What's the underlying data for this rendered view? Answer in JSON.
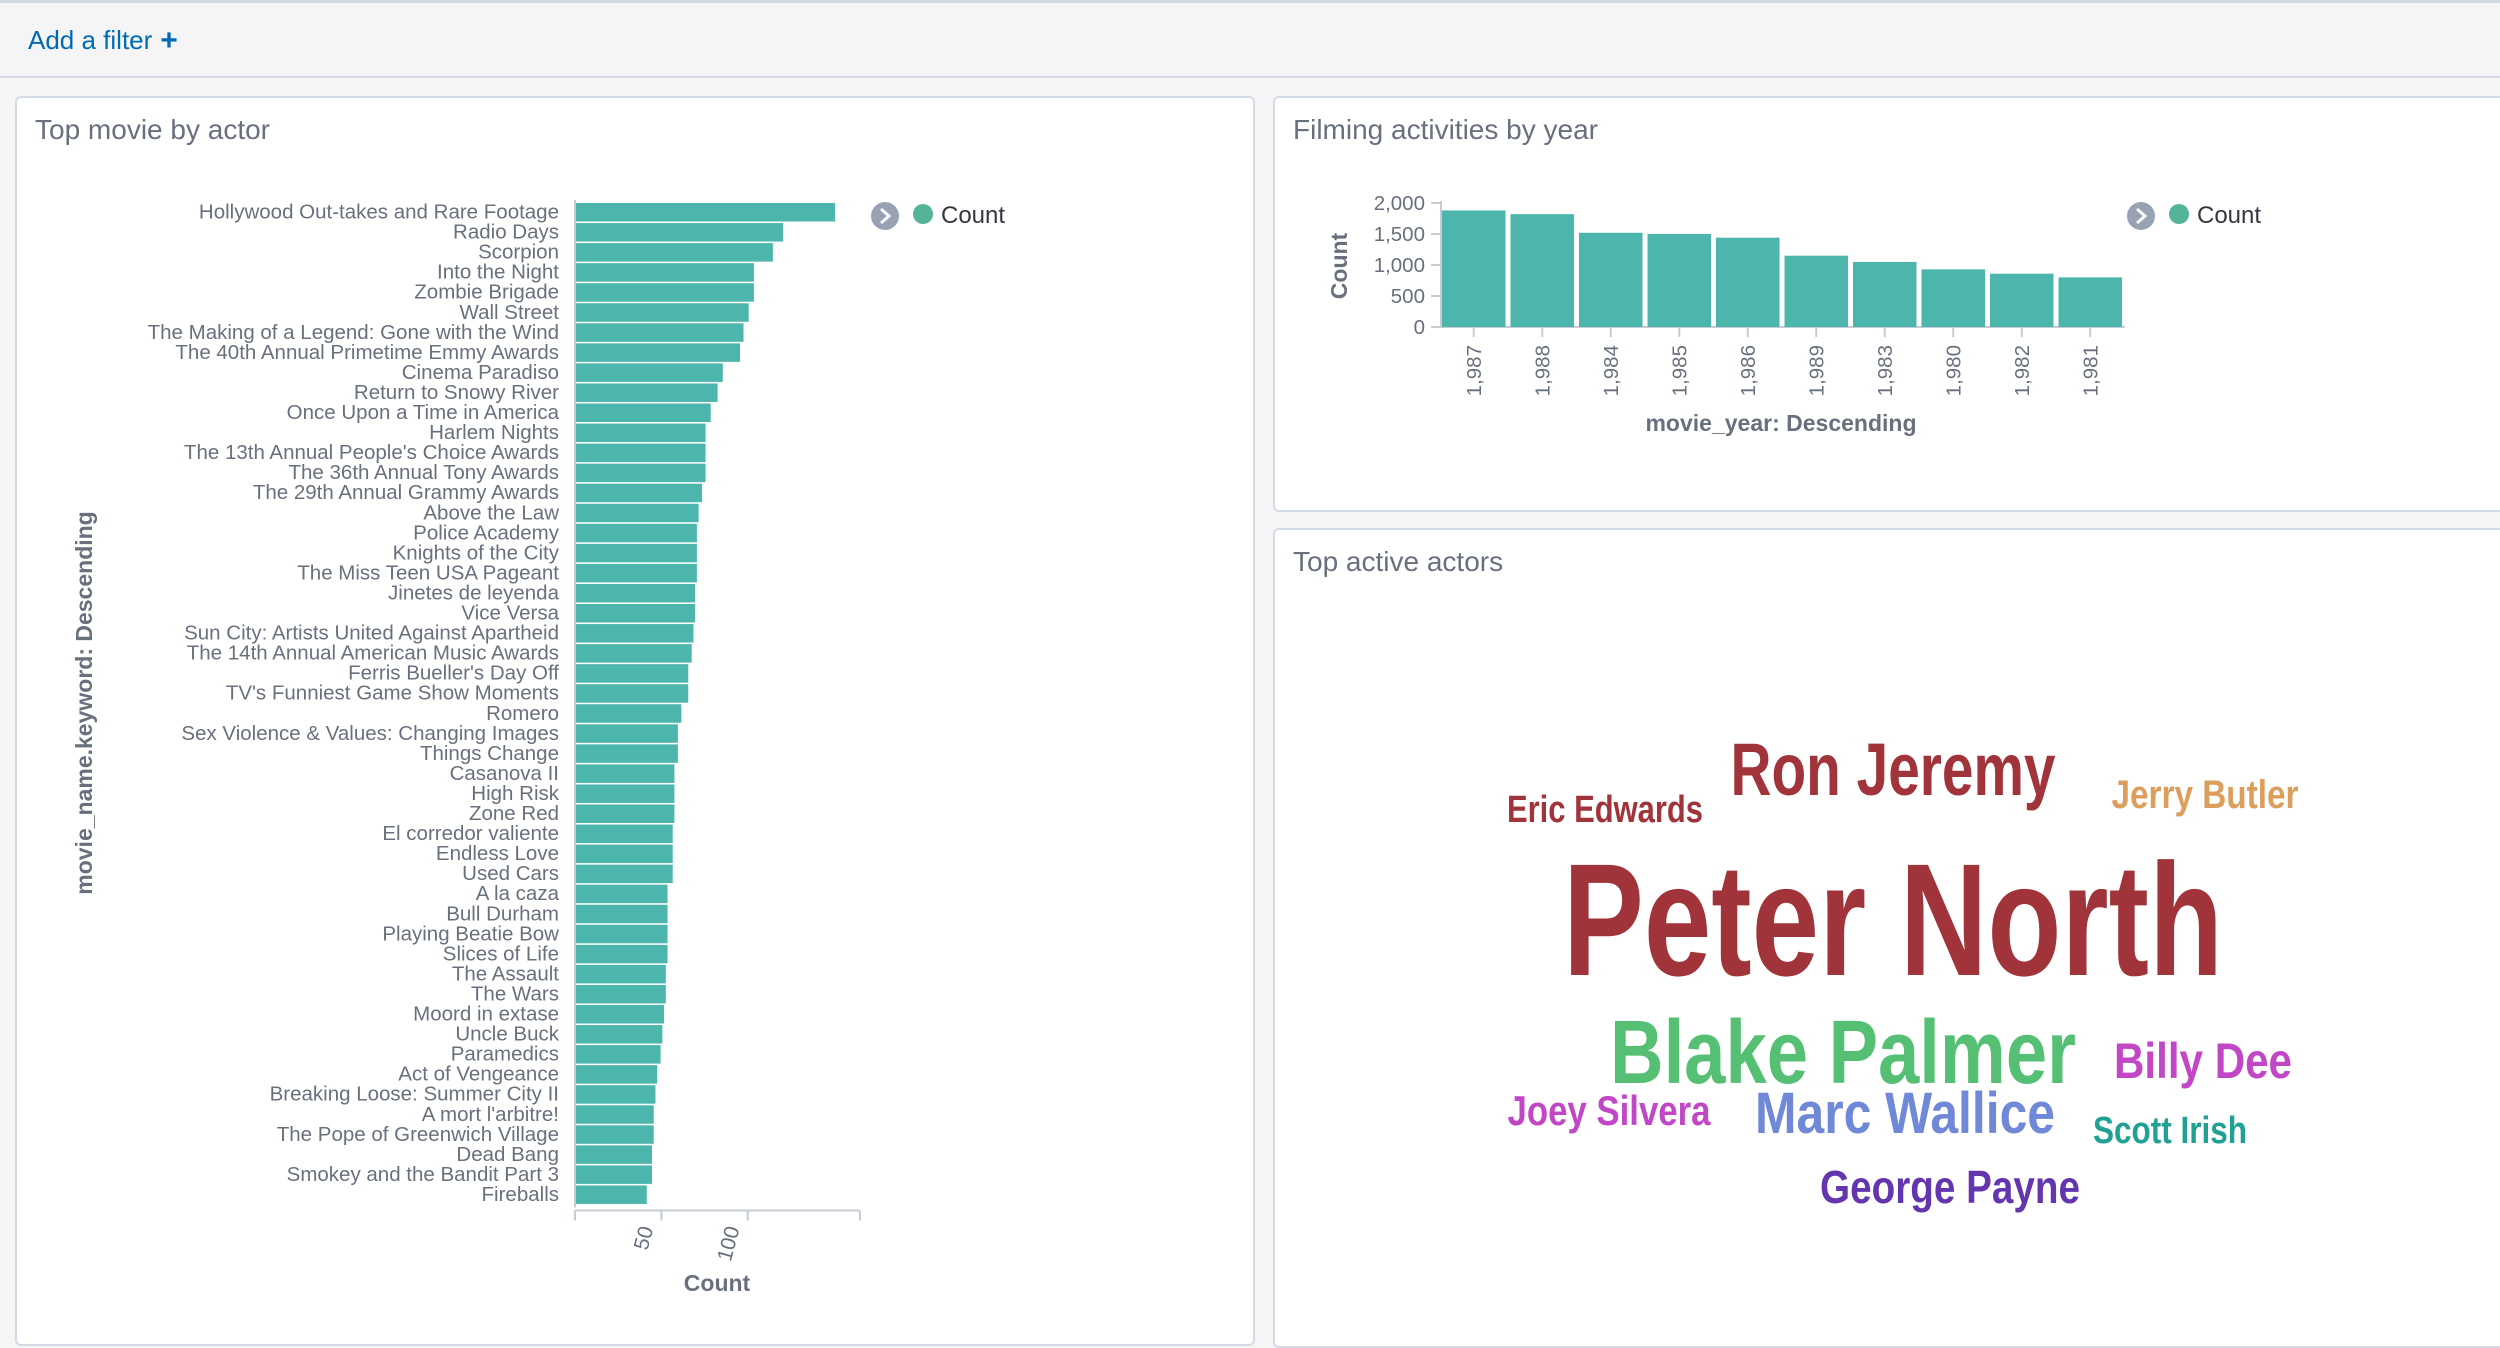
{
  "filter_bar": {
    "add_filter_label": "Add a filter"
  },
  "panels": {
    "top_movie": {
      "title": "Top movie by actor"
    },
    "filming": {
      "title": "Filming activities by year"
    },
    "actors": {
      "title": "Top active actors"
    }
  },
  "chart_data": [
    {
      "type": "bar",
      "orientation": "horizontal",
      "categories": [
        "Hollywood Out-takes and Rare Footage",
        "Radio Days",
        "Scorpion",
        "Into the Night",
        "Zombie Brigade",
        "Wall Street",
        "The Making of a Legend: Gone with the Wind",
        "The 40th Annual Primetime Emmy Awards",
        "Cinema Paradiso",
        "Return to Snowy River",
        "Once Upon a Time in America",
        "Harlem Nights",
        "The 13th Annual People's Choice Awards",
        "The 36th Annual Tony Awards",
        "The 29th Annual Grammy Awards",
        "Above the Law",
        "Police Academy",
        "Knights of the City",
        "The Miss Teen USA Pageant",
        "Jinetes de leyenda",
        "Vice Versa",
        "Sun City: Artists United Against Apartheid",
        "The 14th Annual American Music Awards",
        "Ferris Bueller's Day Off",
        "TV's Funniest Game Show Moments",
        "Romero",
        "Sex Violence & Values: Changing Images",
        "Things Change",
        "Casanova II",
        "High Risk",
        "Zone Red",
        "El corredor valiente",
        "Endless Love",
        "Used Cars",
        "A la caza",
        "Bull Durham",
        "Playing Beatie Bow",
        "Slices of Life",
        "The Assault",
        "The Wars",
        "Moord in extase",
        "Uncle Buck",
        "Paramedics",
        "Act of Vengeance",
        "Breaking Loose: Summer City II",
        "A mort l'arbitre!",
        "The Pope of Greenwich Village",
        "Dead Bang",
        "Smokey and the Bandit Part 3",
        "Fireballs"
      ],
      "values": [
        150,
        120,
        114,
        103,
        103,
        100,
        97,
        95,
        85,
        82,
        78,
        75,
        75,
        75,
        73,
        71,
        70,
        70,
        70,
        69,
        69,
        68,
        67,
        65,
        65,
        61,
        59,
        59,
        57,
        57,
        57,
        56,
        56,
        56,
        53,
        53,
        53,
        53,
        52,
        52,
        51,
        50,
        49,
        47,
        46,
        45,
        45,
        44,
        44,
        41
      ],
      "series": [
        {
          "name": "Count"
        }
      ],
      "xlabel": "Count",
      "ylabel": "movie_name.keyword: Descending",
      "xticks": [
        "50",
        "100"
      ],
      "xlim": [
        0,
        165
      ],
      "legend": "top-right"
    },
    {
      "type": "bar",
      "categories": [
        "1,987",
        "1,988",
        "1,984",
        "1,985",
        "1,986",
        "1,989",
        "1,983",
        "1,980",
        "1,982",
        "1,981"
      ],
      "values": [
        1880,
        1820,
        1520,
        1500,
        1440,
        1150,
        1050,
        930,
        860,
        800
      ],
      "series": [
        {
          "name": "Count"
        }
      ],
      "xlabel": "movie_year: Descending",
      "ylabel": "Count",
      "yticks": [
        "2,000",
        "1,500",
        "1,000",
        "500",
        "0"
      ],
      "ylim": [
        0,
        2000
      ],
      "legend": "top-right"
    }
  ],
  "legend": {
    "label": "Count",
    "color": "#54b399",
    "toggle_icon": "chevron-right-icon"
  },
  "bar_color": "#4db6ac",
  "tag_cloud": [
    {
      "text": "Ron Jeremy",
      "color": "#a1333a"
    },
    {
      "text": "Eric Edwards",
      "color": "#a1333a"
    },
    {
      "text": "Jerry Butler",
      "color": "#dc9e5c"
    },
    {
      "text": "Peter North",
      "color": "#a1333a"
    },
    {
      "text": "Blake Palmer",
      "color": "#55bf74"
    },
    {
      "text": "Billy Dee",
      "color": "#c147c7"
    },
    {
      "text": "Joey Silvera",
      "color": "#c147c7"
    },
    {
      "text": "Marc Wallice",
      "color": "#6f88d8"
    },
    {
      "text": "Scott Irish",
      "color": "#21a194"
    },
    {
      "text": "George Payne",
      "color": "#6336b0"
    }
  ]
}
